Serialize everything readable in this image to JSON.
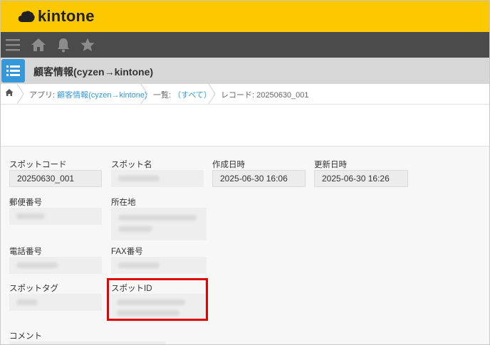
{
  "app": {
    "brand": "kintone",
    "brand_color": "#fcc800",
    "title": "顧客情報(cyzen→kintone)"
  },
  "nav": {
    "icons": [
      "menu-icon",
      "home-icon",
      "bell-icon",
      "star-icon"
    ]
  },
  "breadcrumb": {
    "app_prefix": "アプリ: ",
    "app_link": "顧客情報(cyzen→kintone)",
    "list_prefix": "一覧: ",
    "list_link": "（すべて）",
    "record": "レコード: 20250630_001"
  },
  "fields": {
    "spot_code": {
      "label": "スポットコード",
      "value": "20250630_001"
    },
    "spot_name": {
      "label": "スポット名"
    },
    "created_at": {
      "label": "作成日時",
      "value": "2025-06-30 16:06"
    },
    "updated_at": {
      "label": "更新日時",
      "value": "2025-06-30 16:26"
    },
    "postal_code": {
      "label": "郵便番号"
    },
    "address": {
      "label": "所在地"
    },
    "phone": {
      "label": "電話番号"
    },
    "fax": {
      "label": "FAX番号"
    },
    "spot_tag": {
      "label": "スポットタグ"
    },
    "spot_id": {
      "label": "スポットID"
    },
    "comment": {
      "label": "コメント"
    }
  },
  "colors": {
    "highlight": "#e00000",
    "accent": "#3498db"
  }
}
